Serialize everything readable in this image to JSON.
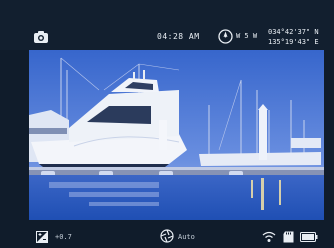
{
  "status": {
    "time": "04:28 AM",
    "heading": "W 5 W",
    "latitude": "034°42'37\" N",
    "longitude": "135°19'43\" E"
  },
  "footer": {
    "exposure": "+0.7",
    "mode": "Auto"
  },
  "icons": {
    "capture": "camera-icon",
    "compass": "compass-icon",
    "exposure": "exposure-icon",
    "mode": "auto-mode-icon",
    "wifi": "wifi-icon",
    "storage": "sd-card-icon",
    "battery": "battery-icon"
  },
  "colors": {
    "background": "#101c2b",
    "text": "#e9eef4",
    "sky": "#3f6fd0",
    "water": "#2d5fc0"
  }
}
